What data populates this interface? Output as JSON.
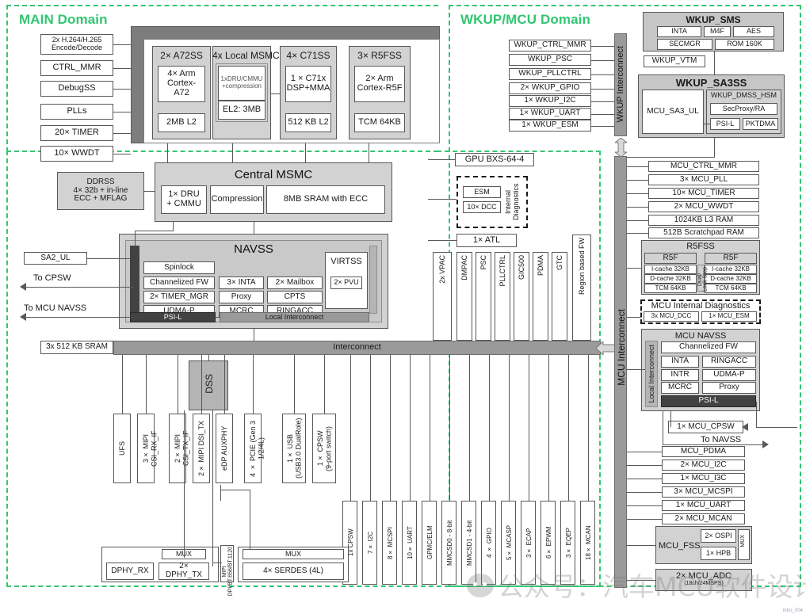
{
  "domains": {
    "main": "MAIN Domain",
    "wkup": "WKUP/MCU Domain"
  },
  "main_left_blocks": [
    {
      "label": "2x H.264/H.265\nEncode/Decode"
    },
    {
      "label": "CTRL_MMR"
    },
    {
      "label": "DebugSS"
    },
    {
      "label": "PLLs"
    },
    {
      "label": "20× TIMER"
    },
    {
      "label": "10× WWDT"
    }
  ],
  "compute_clusters": [
    {
      "title": "2× A72SS",
      "inner": [
        {
          "label": "4× Arm\nCortex-A72"
        },
        {
          "label": "2MB L2"
        }
      ]
    },
    {
      "title": "4x Local MSMC",
      "inner": [
        {
          "label": "1xDRU/CMMU\n+compression",
          "small": true
        },
        {
          "label": "EL2: 3MB"
        }
      ]
    },
    {
      "title": "4× C71SS",
      "inner": [
        {
          "label": "1 × C71x\nDSP+MMA"
        },
        {
          "label": "512 KB L2"
        }
      ]
    },
    {
      "title": "3× R5FSS",
      "inner": [
        {
          "label": "2× Arm\nCortex-R5F"
        },
        {
          "label": "TCM 64KB"
        }
      ]
    }
  ],
  "ddrss": {
    "label": "DDRSS\n4× 32b + in-line\nECC + MFLAG"
  },
  "central_msmc": {
    "title": "Central MSMC",
    "blocks": [
      "1× DRU\n+ CMMU",
      "Compression",
      "8MB SRAM with ECC"
    ]
  },
  "navss": {
    "title": "NAVSS",
    "psi_l": "PSI-L",
    "local_interconnect": "Local Interconnect",
    "col1": [
      "Spinlock",
      "Channelized FW",
      "2× TIMER_MGR",
      "UDMA-P"
    ],
    "col2": [
      "3× INTA",
      "Proxy",
      "MCRC"
    ],
    "col3": [
      "2× Mailbox",
      "CPTS",
      "RINGACC"
    ],
    "virtss": {
      "title": "VIRTSS",
      "inner": "2× PVU"
    }
  },
  "left_edge": {
    "sa2_ul": "SA2_UL",
    "to_cpsw": "To CPSW",
    "to_mcu_navss": "To MCU NAVSS",
    "sram": "3x 512 KB SRAM"
  },
  "interconnect": {
    "label": "Interconnect"
  },
  "mcu_interconnect": {
    "label": "MCU Interconnect"
  },
  "wkup_interconnect": {
    "label": "WKUP Interconnect"
  },
  "main_mid_right": {
    "gpu": "GPU BXS-64-4",
    "diagnostics": {
      "title": "Internal\nDiagnostics",
      "items": [
        "ESM",
        "10× DCC"
      ]
    },
    "atl": "1× ATL",
    "vertical_blocks": [
      "2x VPAC",
      "DMPAC",
      "PSC",
      "PLLCTRL",
      "GIC500",
      "PDMA",
      "GTC",
      "Region based FW"
    ]
  },
  "dss": {
    "label": "DSS"
  },
  "phy_column": [
    "UFS",
    "3× MIPI CSI_RX_IF",
    "2× MIPI CSI_TX_IF",
    "2× MIPI DSI_TX",
    "eDP AUXPHY",
    "4 × PCIE (Gen 3 1/2/4L)",
    "1× USB\n(USB3.0 DualRole)",
    "1× CPSW\n(9-port switch)"
  ],
  "periph_column": [
    "1x CPSW",
    "7× I2C",
    "8× MCSPI",
    "10× UART",
    "GPMC/ELM",
    "MMCSD0 - 8-bit",
    "MMCSD1 - 4-bit",
    "4 × GPIO",
    "5× MCASP",
    "3× ECAP",
    "6× EPWM",
    "3× EQEP",
    "18× MCAN"
  ],
  "bottom_groups": {
    "dphy": {
      "mux": "MUX",
      "rx": "DPHY_RX",
      "tx": "2× DPHY_TX"
    },
    "mipi_narrow": "MIPI\nDPI/BT.656/BT.1120",
    "serdes": {
      "mux": "MUX",
      "label": "4× SERDES (4L)"
    }
  },
  "wkup": {
    "left_blocks": [
      "WKUP_CTRL_MMR",
      "WKUP_PSC",
      "WKUP_PLLCTRL",
      "2× WKUP_GPIO",
      "1× WKUP_I2C",
      "1× WKUP_UART",
      "1× WKUP_ESM"
    ],
    "sms": {
      "title": "WKUP_SMS",
      "row1": [
        "INTA",
        "M4F",
        "AES"
      ],
      "row2": [
        "SECMGR",
        "ROM 160K"
      ]
    },
    "vtm": "WKUP_VTM",
    "sa3ss": {
      "title": "WKUP_SA3SS",
      "left": "MCU_SA3_UL",
      "hsm_title": "WKUP_DMSS_HSM",
      "secproxy": "SecProxy/RA",
      "psi_l": "PSI-L",
      "pktdma": "PKTDMA"
    }
  },
  "mcu": {
    "top_blocks": [
      "MCU_CTRL_MMR",
      "3× MCU_PLL",
      "10× MCU_TIMER",
      "2× MCU_WWDT",
      "1024KB L3 RAM",
      "512B Scratchpad RAM"
    ],
    "r5fss": {
      "title": "R5FSS",
      "core_title": "R5F",
      "rows": [
        "I-cache 32KB",
        "D-cache 32KB",
        "TCM 64KB"
      ],
      "lockstep": "Dual/\nLock Step"
    },
    "diagnostics": {
      "title": "MCU Internal Diagnostics",
      "items": [
        "3x MCU_DCC",
        "1× MCU_ESM"
      ]
    },
    "navss": {
      "title": "MCU NAVSS",
      "local_interconnect": "Local Interconnect",
      "full": "Channelized FW",
      "col1": [
        "INTA",
        "INTR",
        "MCRC"
      ],
      "col2": [
        "RINGACC",
        "UDMA-P",
        "Proxy"
      ],
      "psi_l": "PSI-L"
    },
    "cpsw": "1× MCU_CPSW",
    "to_navss": "To NAVSS",
    "bottom_blocks": [
      "MCU_PDMA",
      "2× MCU_I2C",
      "1× MCU_I3C",
      "3× MCU_MCSPI",
      "1× MCU_UART",
      "2× MCU_MCAN"
    ],
    "fss": {
      "title": "MCU_FSS",
      "ospi": "2× OSPI",
      "hpb": "1× HPB",
      "mux": "MUX"
    },
    "adc": {
      "label": "2× MCU_ADC",
      "sub": "(18ch/24MSPS)"
    }
  },
  "watermark": {
    "text": "公众号：汽车MCU软件设计",
    "credit": "intro_004"
  },
  "colors": {
    "domain_green": "#32c671",
    "block_border": "#58585a",
    "gray_fill": "#d2d2d2",
    "bar_gray": "#9a9a9a",
    "dark_bar": "#424242"
  }
}
